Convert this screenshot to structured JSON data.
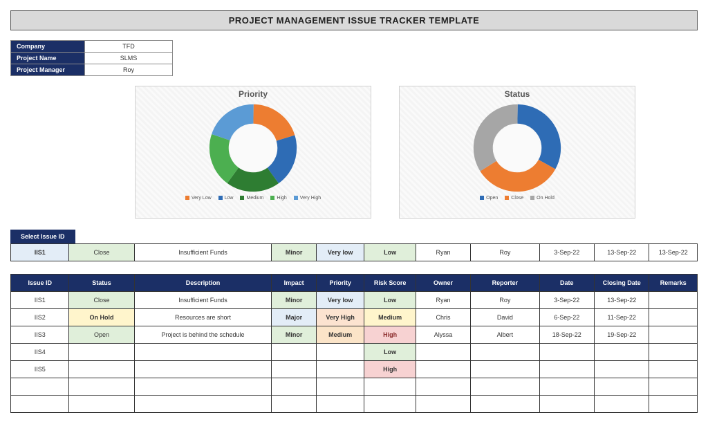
{
  "title": "PROJECT MANAGEMENT ISSUE TRACKER TEMPLATE",
  "info": {
    "company_label": "Company",
    "company": "TFD",
    "project_label": "Project Name",
    "project": "SLMS",
    "manager_label": "Project Manager",
    "manager": "Roy"
  },
  "chart_data": [
    {
      "type": "pie",
      "title": "Priority",
      "series": [
        {
          "name": "Very Low",
          "value": 20,
          "color": "#ed7d31"
        },
        {
          "name": "Low",
          "value": 20,
          "color": "#2e6cb5"
        },
        {
          "name": "Medium",
          "value": 20,
          "color": "#2e7d32"
        },
        {
          "name": "High",
          "value": 20,
          "color": "#4caf50"
        },
        {
          "name": "Very High",
          "value": 20,
          "color": "#5b9bd5"
        }
      ]
    },
    {
      "type": "pie",
      "title": "Status",
      "series": [
        {
          "name": "Open",
          "value": 33,
          "color": "#2e6cb5"
        },
        {
          "name": "Close",
          "value": 33,
          "color": "#ed7d31"
        },
        {
          "name": "On Hold",
          "value": 34,
          "color": "#a6a6a6"
        }
      ]
    }
  ],
  "select_label": "Select Issue ID",
  "selected": {
    "id": "IIS1",
    "status": "Close",
    "desc": "Insufficient Funds",
    "impact": "Minor",
    "priority": "Very low",
    "risk": "Low",
    "owner": "Ryan",
    "reporter": "Roy",
    "date": "3-Sep-22",
    "closing": "13-Sep-22",
    "remarks": "13-Sep-22"
  },
  "headers": {
    "id": "Issue ID",
    "status": "Status",
    "desc": "Description",
    "impact": "Impact",
    "priority": "Priority",
    "risk": "Risk Score",
    "owner": "Owner",
    "reporter": "Reporter",
    "date": "Date",
    "closing": "Closing Date",
    "remarks": "Remarks"
  },
  "rows": [
    {
      "id": "IIS1",
      "status": "Close",
      "desc": "Insufficient Funds",
      "impact": "Minor",
      "priority": "Very low",
      "risk": "Low",
      "owner": "Ryan",
      "reporter": "Roy",
      "date": "3-Sep-22",
      "closing": "13-Sep-22",
      "remarks": ""
    },
    {
      "id": "IIS2",
      "status": "On Hold",
      "desc": "Resources are short",
      "impact": "Major",
      "priority": "Very High",
      "risk": "Medium",
      "owner": "Chris",
      "reporter": "David",
      "date": "6-Sep-22",
      "closing": "11-Sep-22",
      "remarks": ""
    },
    {
      "id": "IIS3",
      "status": "Open",
      "desc": "Project is behind the schedule",
      "impact": "Minor",
      "priority": "Medium",
      "risk": "High",
      "owner": "Alyssa",
      "reporter": "Albert",
      "date": "18-Sep-22",
      "closing": "19-Sep-22",
      "remarks": ""
    },
    {
      "id": "IIS4",
      "status": "",
      "desc": "",
      "impact": "",
      "priority": "",
      "risk": "Low",
      "owner": "",
      "reporter": "",
      "date": "",
      "closing": "",
      "remarks": ""
    },
    {
      "id": "IIS5",
      "status": "",
      "desc": "",
      "impact": "",
      "priority": "",
      "risk": "High",
      "owner": "",
      "reporter": "",
      "date": "",
      "closing": "",
      "remarks": ""
    },
    {
      "id": "",
      "status": "",
      "desc": "",
      "impact": "",
      "priority": "",
      "risk": "",
      "owner": "",
      "reporter": "",
      "date": "",
      "closing": "",
      "remarks": ""
    },
    {
      "id": "",
      "status": "",
      "desc": "",
      "impact": "",
      "priority": "",
      "risk": "",
      "owner": "",
      "reporter": "",
      "date": "",
      "closing": "",
      "remarks": ""
    }
  ]
}
